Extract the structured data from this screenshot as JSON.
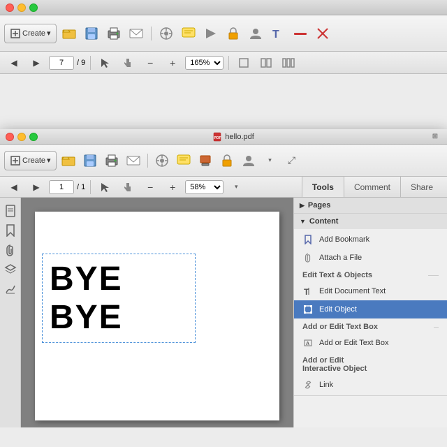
{
  "bgWindow": {
    "trafficLights": [
      "red",
      "yellow",
      "green"
    ],
    "title": "",
    "toolbar": {
      "createBtn": "Create",
      "icons": [
        "folder-open",
        "save",
        "print",
        "email",
        "tools",
        "comment",
        "arrow",
        "lock",
        "user",
        "text",
        "minus",
        "close"
      ]
    },
    "nav": {
      "currentPage": "7",
      "totalPages": "9",
      "zoom": "165%",
      "icons": [
        "back",
        "forward",
        "select",
        "hand",
        "zoomOut",
        "zoomIn",
        "layout1",
        "layout2",
        "layout3"
      ]
    }
  },
  "fgWindow": {
    "trafficLights": [
      "red",
      "yellow",
      "green"
    ],
    "title": "hello.pdf",
    "toolbar": {
      "createBtn": "Create",
      "icons": [
        "folder-open",
        "save",
        "print",
        "email",
        "tools",
        "comment",
        "arrow",
        "lock",
        "user",
        "maximize"
      ]
    },
    "nav": {
      "currentPage": "1",
      "totalPages": "1",
      "zoom": "58%",
      "icons": [
        "back",
        "forward",
        "select",
        "hand",
        "zoomOut",
        "zoomIn",
        "arrow-down"
      ]
    },
    "tabs": [
      {
        "id": "tools",
        "label": "Tools",
        "active": true
      },
      {
        "id": "comment",
        "label": "Comment",
        "active": false
      },
      {
        "id": "share",
        "label": "Share",
        "active": false
      }
    ],
    "document": {
      "pageContent": "BYE BYE"
    },
    "rightPanel": {
      "sections": [
        {
          "id": "pages",
          "label": "Pages",
          "collapsed": true,
          "items": []
        },
        {
          "id": "content",
          "label": "Content",
          "collapsed": false,
          "items": [
            {
              "id": "add-bookmark",
              "label": "Add Bookmark",
              "icon": "🔖",
              "selected": false
            },
            {
              "id": "attach-file",
              "label": "Attach a File",
              "icon": "📎",
              "selected": false
            }
          ],
          "groups": [
            {
              "id": "edit-text-objects",
              "label": "Edit Text & Objects",
              "items": [
                {
                  "id": "edit-document-text",
                  "label": "Edit Document Text",
                  "icon": "T|",
                  "selected": false
                },
                {
                  "id": "edit-object",
                  "label": "Edit Object",
                  "icon": "⬜",
                  "selected": true
                }
              ]
            },
            {
              "id": "add-edit-text-box",
              "label": "Add or Edit Text Box",
              "items": [
                {
                  "id": "text-box",
                  "label": "Add or Edit Text Box",
                  "icon": "⬜",
                  "selected": false
                }
              ]
            },
            {
              "id": "add-edit-interactive",
              "label": "Add or Edit Interactive Object",
              "items": [
                {
                  "id": "link",
                  "label": "Link",
                  "icon": "🔗",
                  "selected": false
                }
              ]
            }
          ]
        }
      ]
    }
  }
}
